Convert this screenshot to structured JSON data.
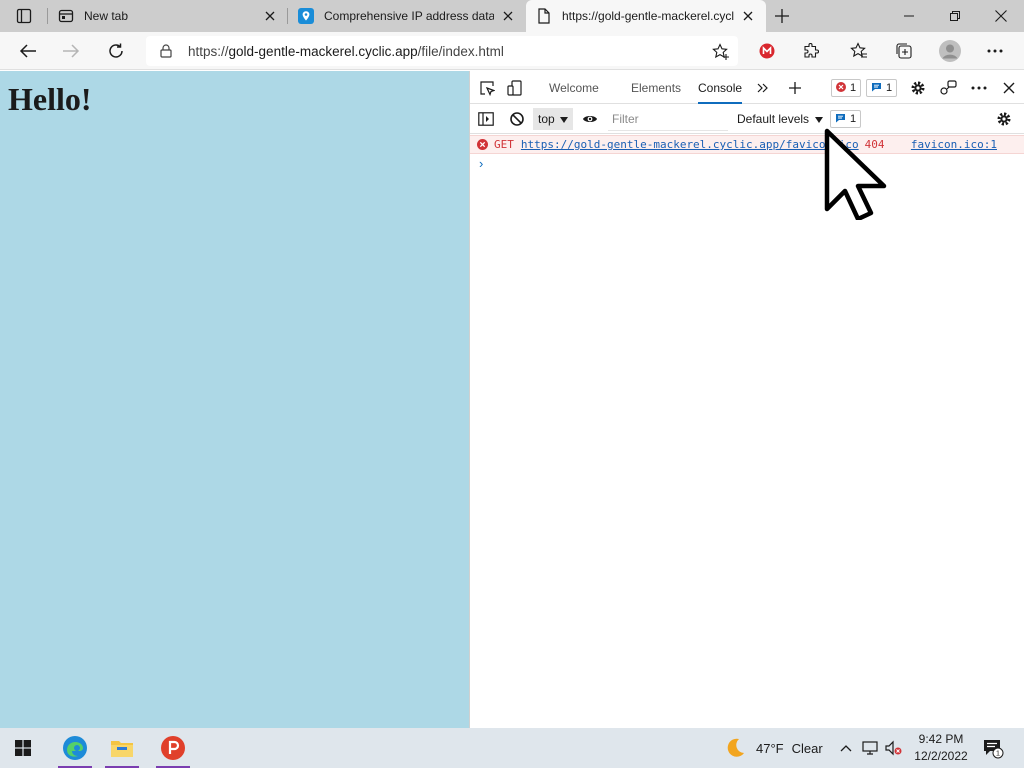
{
  "tabs": [
    {
      "title": "New tab",
      "active": false
    },
    {
      "title": "Comprehensive IP address data,",
      "active": false
    },
    {
      "title": "https://gold-gentle-mackerel.cyclic.app/file/index.html",
      "active": true
    }
  ],
  "address_bar": {
    "url_prefix": "https://",
    "url_host": "gold-gentle-mackerel.cyclic.app",
    "url_path": "/file/index.html"
  },
  "page": {
    "heading": "Hello!",
    "background_color": "#add8e6"
  },
  "devtools": {
    "tabs": [
      "Welcome",
      "Elements",
      "Console"
    ],
    "active_tab": "Console",
    "error_count": "1",
    "message_count": "1",
    "context": "top",
    "filter_placeholder": "Filter",
    "levels_label": "Default levels",
    "issues_count": "1",
    "console_messages": [
      {
        "level": "error",
        "method": "GET",
        "url": "https://gold-gentle-mackerel.cyclic.app/favicon.ico",
        "status": "404",
        "source": "favicon.ico:1"
      }
    ],
    "prompt_symbol": "›"
  },
  "taskbar": {
    "weather_temp": "47°F",
    "weather_desc": "Clear",
    "time": "9:42 PM",
    "date": "12/2/2022",
    "notification_count": "1"
  },
  "colors": {
    "accent": "#0f6cbd",
    "error": "#d13438",
    "error_bg": "#fdefee",
    "running_indicator": "#7a3db0"
  }
}
